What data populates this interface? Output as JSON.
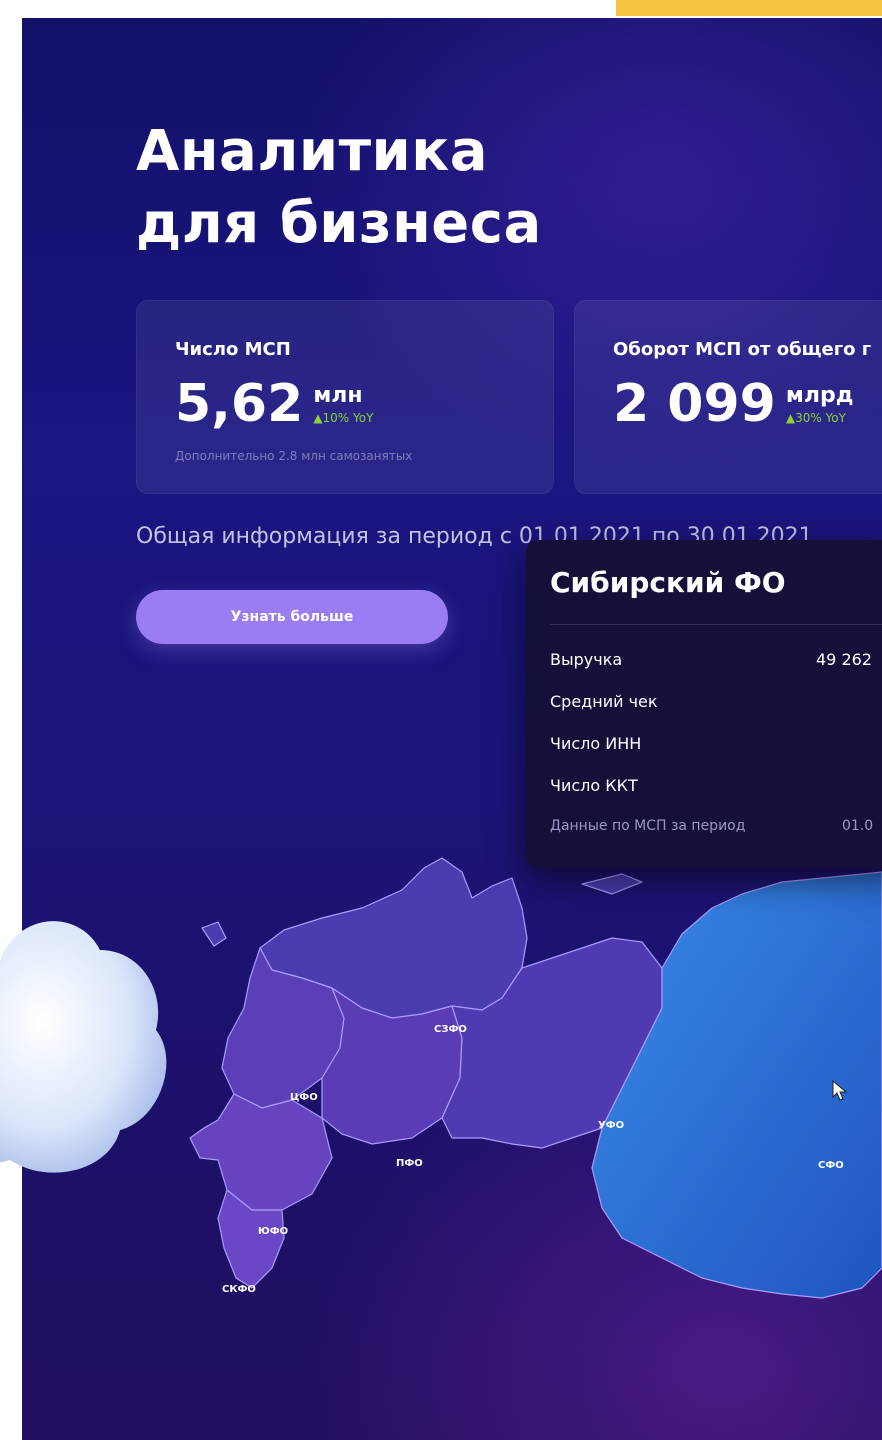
{
  "hero": {
    "title_line1": "Аналитика",
    "title_line2": "для бизнеса"
  },
  "stats": [
    {
      "label": "Число МСП",
      "value": "5,62",
      "unit": "млн",
      "yoy": "▲10% YoY",
      "note": "Дополнительно 2.8 млн самозанятых"
    },
    {
      "label": "Оборот МСП от общего г",
      "value": "2 099",
      "unit": "млрд",
      "yoy": "▲30% YoY"
    }
  ],
  "period_text": "Общая информация за период с 01.01.2021 по 30.01.2021",
  "cta_label": "Узнать больше",
  "popup": {
    "title": "Сибирский ФО",
    "rows": [
      {
        "label": "Выручка",
        "value": "49 262"
      },
      {
        "label": "Средний чек",
        "value": ""
      },
      {
        "label": "Число ИНН",
        "value": ""
      },
      {
        "label": "Число ККТ",
        "value": ""
      },
      {
        "label": "Данные по МСП за период",
        "value": "01.0"
      }
    ]
  },
  "map": {
    "regions": [
      {
        "id": "szfo",
        "label": "СЗФО",
        "color": "#4b3db0"
      },
      {
        "id": "cfo",
        "label": "ЦФО",
        "color": "#5b3fb8"
      },
      {
        "id": "pfo",
        "label": "ПФО",
        "color": "#5a3cb6"
      },
      {
        "id": "yfo",
        "label": "ЮФО",
        "color": "#6643bf"
      },
      {
        "id": "skfo",
        "label": "СКФО",
        "color": "#6a47c4"
      },
      {
        "id": "ufo",
        "label": "УФО",
        "color": "#4f3ab2"
      },
      {
        "id": "sfo",
        "label": "СФО",
        "color": "#2f6fd6"
      }
    ]
  },
  "colors": {
    "accent_yellow": "#f5c542",
    "panel_bg": "#1a1580",
    "button": "#9a7df2",
    "yoy_green": "#8ad13c",
    "popup_bg": "#15103a"
  }
}
